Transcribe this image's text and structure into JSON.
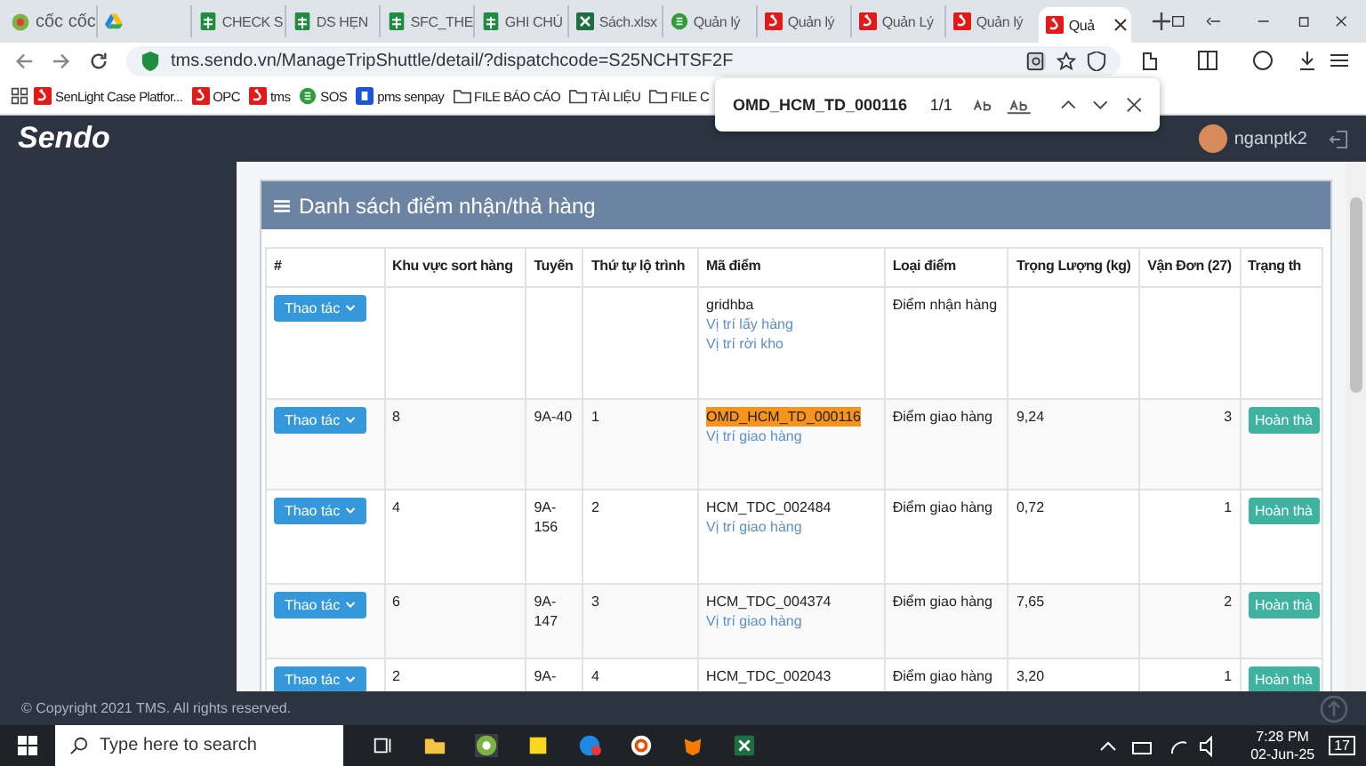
{
  "browser": {
    "brand": "cốc cốc",
    "tabs": [
      {
        "kind": "drive",
        "selected": false
      },
      {
        "kind": "sheet",
        "label": "CHECK S",
        "selected": false
      },
      {
        "kind": "sheet",
        "label": "DS HẸN",
        "selected": false
      },
      {
        "kind": "sheet",
        "label": "SFC_THE",
        "selected": false
      },
      {
        "kind": "sheet",
        "label": "GHI CHÚ",
        "selected": false
      },
      {
        "kind": "excel",
        "label": "Sách.xlsx",
        "selected": false
      },
      {
        "kind": "circle",
        "label": "Quản lý",
        "selected": false
      },
      {
        "kind": "sendo",
        "label": "Quản lý",
        "selected": false
      },
      {
        "kind": "sendo",
        "label": "Quản Lý",
        "selected": false
      },
      {
        "kind": "sendo",
        "label": "Quản lý",
        "selected": false
      },
      {
        "kind": "sendo",
        "label": "Quả",
        "selected": true
      }
    ],
    "address": "tms.sendo.vn/ManageTripShuttle/detail/?dispatchcode=S25NCHTSF2F",
    "bookmarks": [
      {
        "kind": "sendo",
        "label": "SenLight Case Platfor..."
      },
      {
        "kind": "sendo",
        "label": "OPC"
      },
      {
        "kind": "sendo",
        "label": "tms"
      },
      {
        "kind": "circle",
        "label": "SOS"
      },
      {
        "kind": "p",
        "label": "pms senpay"
      },
      {
        "kind": "folder",
        "label": "FILE BÁO CÁO"
      },
      {
        "kind": "folder",
        "label": "TÀI LIỆU"
      },
      {
        "kind": "folder",
        "label": "FILE C"
      }
    ]
  },
  "find_bar": {
    "query": "OMD_HCM_TD_000116",
    "count": "1/1"
  },
  "app": {
    "logo": "Sendo",
    "user": "nganptk2"
  },
  "panel": {
    "title": "Danh sách điểm nhận/thả hàng",
    "columns": [
      "#",
      "Khu vực sort hàng",
      "Tuyến",
      "Thứ tự lộ trình",
      "Mã điểm",
      "Loại điểm",
      "Trọng Lượng (kg)",
      "Vận Đơn (27)",
      "Trạng th"
    ],
    "rows": [
      {
        "action": "Thao tác",
        "sort_area": "",
        "route": "",
        "order": "",
        "code": "gridhba",
        "highlighted": false,
        "links": [
          "Vị trí lấy hàng",
          "Vị trí rời kho"
        ],
        "type": "Điểm nhận hàng",
        "weight": "",
        "orders": "",
        "status": ""
      },
      {
        "action": "Thao tác",
        "sort_area": "8",
        "route": "9A-40",
        "order": "1",
        "code": "OMD_HCM_TD_000116",
        "highlighted": true,
        "links": [
          "Vị trí giao hàng"
        ],
        "type": "Điểm giao hàng",
        "weight": "9,24",
        "orders": "3",
        "status": "Hoàn thà"
      },
      {
        "action": "Thao tác",
        "sort_area": "4",
        "route": "9A-156",
        "order": "2",
        "code": "HCM_TDC_002484",
        "highlighted": false,
        "links": [
          "Vị trí giao hàng"
        ],
        "type": "Điểm giao hàng",
        "weight": "0,72",
        "orders": "1",
        "status": "Hoàn thà"
      },
      {
        "action": "Thao tác",
        "sort_area": "6",
        "route": "9A-147",
        "order": "3",
        "code": "HCM_TDC_004374",
        "highlighted": false,
        "links": [
          "Vị trí giao hàng"
        ],
        "type": "Điểm giao hàng",
        "weight": "7,65",
        "orders": "2",
        "status": "Hoàn thà"
      },
      {
        "action": "Thao tác",
        "sort_area": "2",
        "route": "9A-",
        "order": "4",
        "code": "HCM_TDC_002043",
        "highlighted": false,
        "links": [],
        "type": "Điểm giao hàng",
        "weight": "3,20",
        "orders": "1",
        "status": "Hoàn thà"
      }
    ]
  },
  "footer": "© Copyright 2021 TMS. All rights reserved.",
  "taskbar": {
    "search_placeholder": "Type here to search",
    "time": "7:28 PM",
    "date": "02-Jun-25",
    "notifications": "17"
  }
}
